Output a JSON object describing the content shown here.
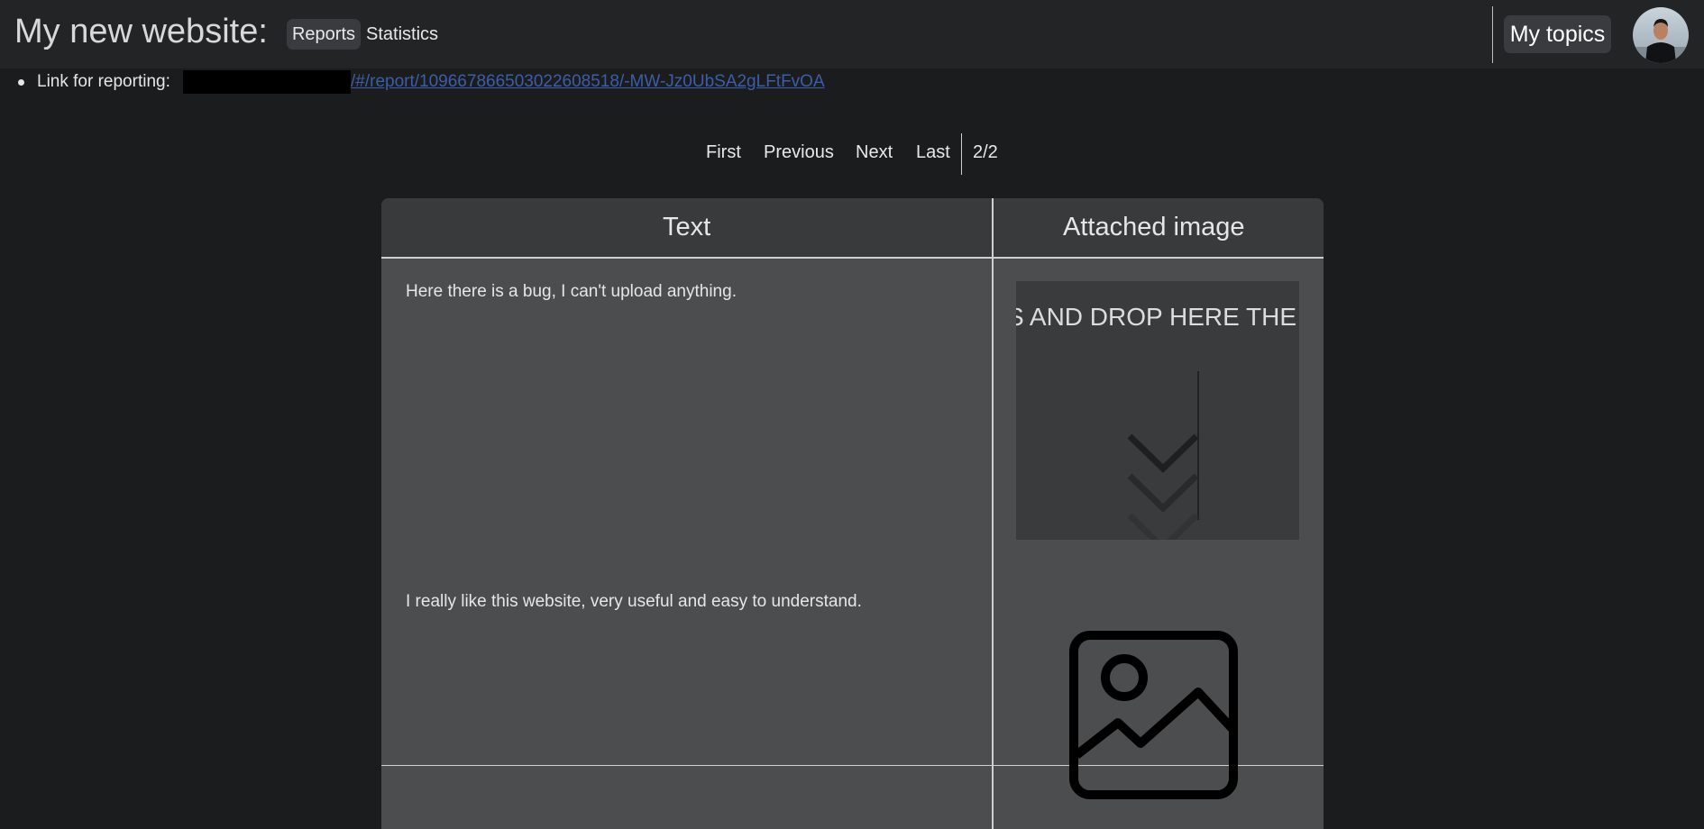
{
  "header": {
    "site_title": "My new website:",
    "nav": [
      "Reports",
      "Statistics"
    ],
    "my_topics": "My topics"
  },
  "report": {
    "label": "Link for reporting:",
    "link_text": "/#/report/10966786650302260851​8/-MW-Jz0UbSA2gLFtFvOA"
  },
  "pagination": {
    "first": "First",
    "previous": "Previous",
    "next": "Next",
    "last": "Last",
    "page_indicator": "2/2"
  },
  "table": {
    "headers": [
      "Text",
      "Attached image"
    ],
    "rows": [
      {
        "text": "Here there is a bug, I can't upload anything.",
        "image_caption": "S AND DROP HERE THE"
      },
      {
        "text": "I really like this website, very useful and easy to understand."
      }
    ]
  },
  "colors": {
    "background": "#1b1c1e",
    "topbar": "#232426",
    "cell": "#4c4d4f",
    "header_cell": "#393a3c",
    "link": "#3b5ea8"
  }
}
